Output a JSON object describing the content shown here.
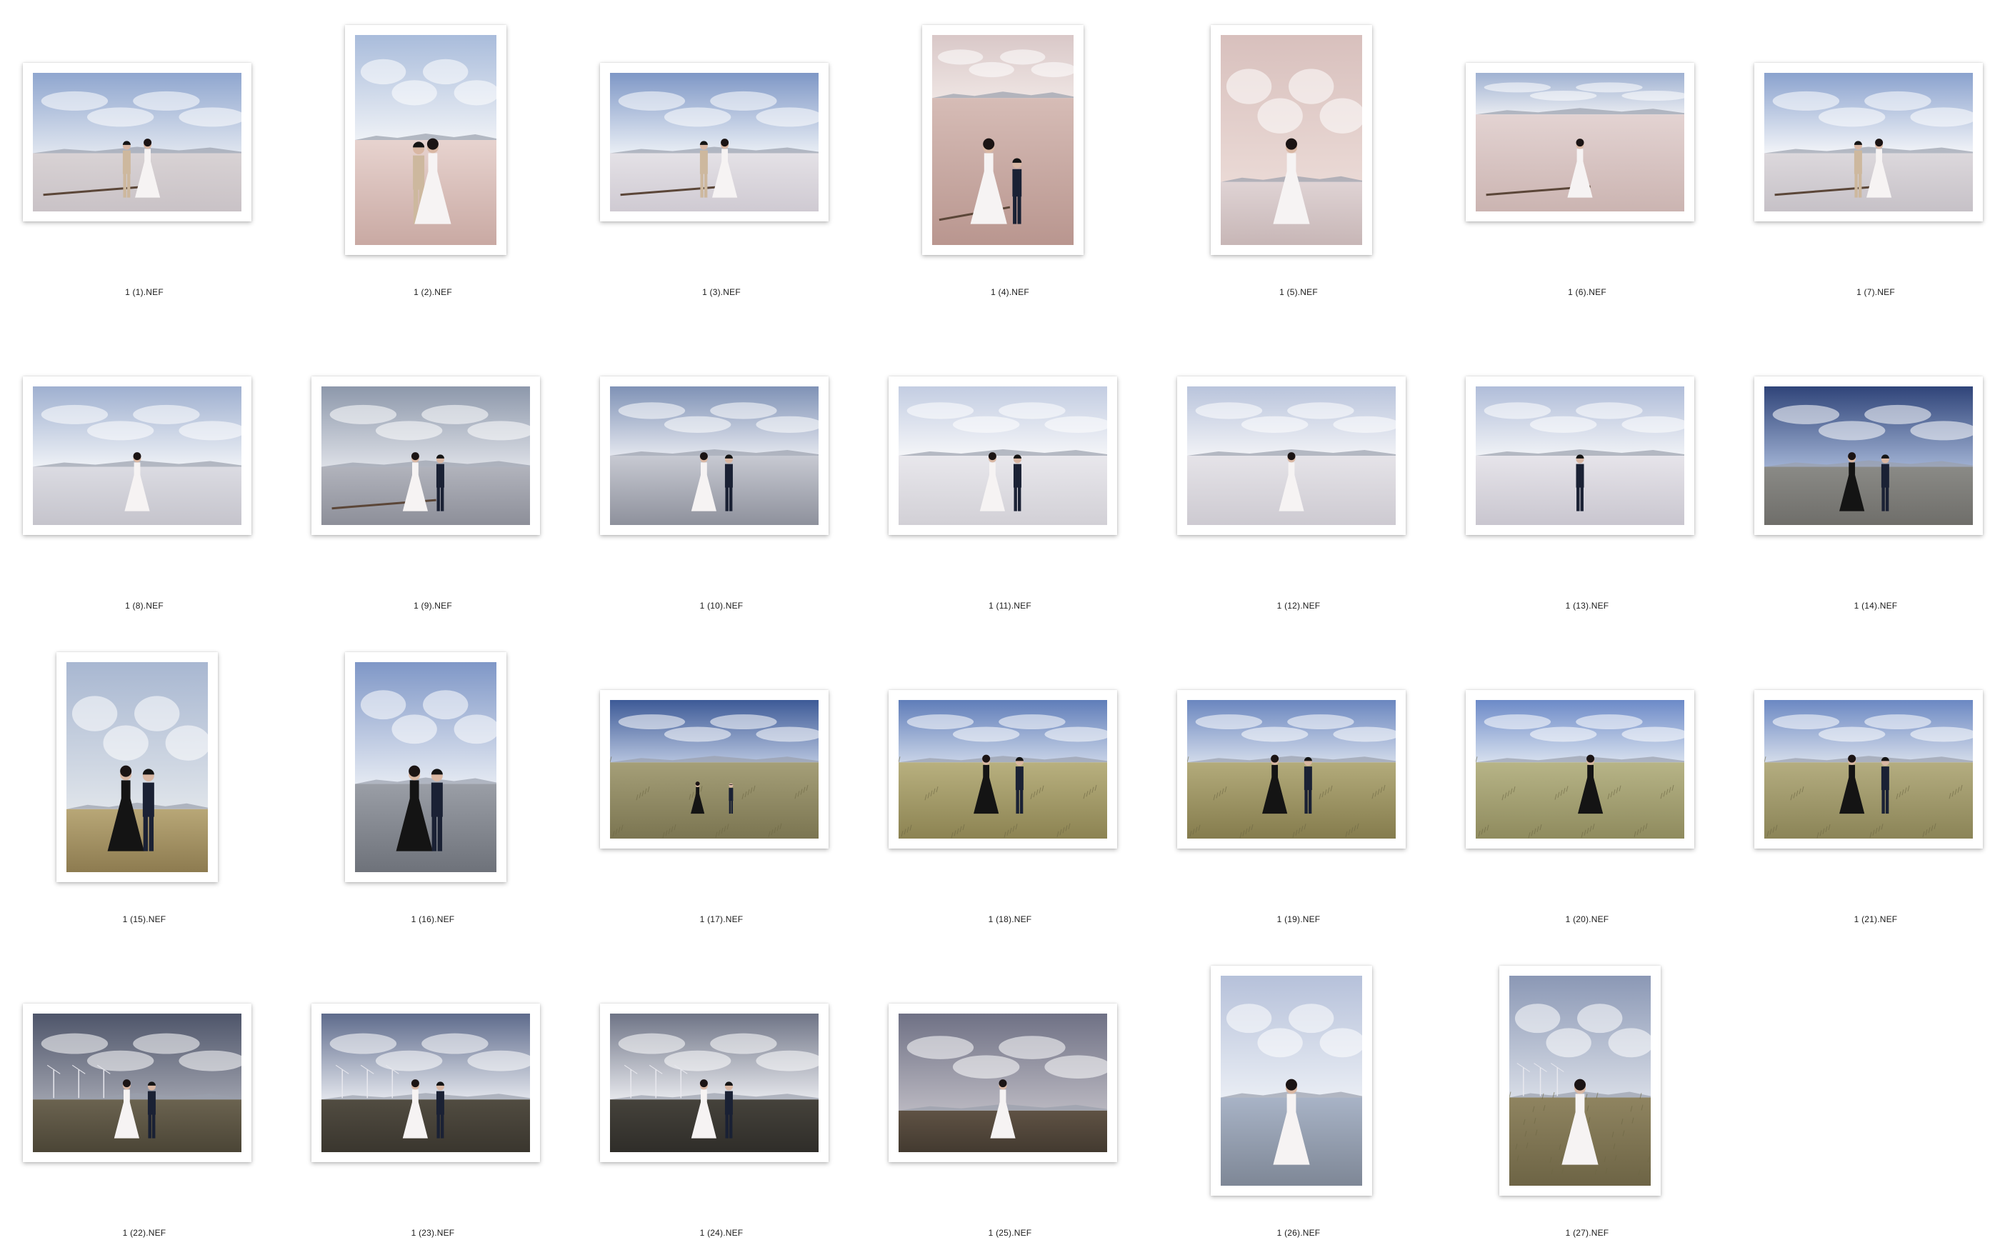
{
  "photos": [
    {
      "filename": "1 (1).NEF",
      "orientation": "landscape",
      "scene": "salt-lake",
      "sky": [
        "#8fa6cf",
        "#dfe5ef"
      ],
      "ground": [
        "#d8d2d4",
        "#c9c2c6"
      ],
      "subject": "couple-light"
    },
    {
      "filename": "1 (2).NEF",
      "orientation": "portrait",
      "scene": "reflection",
      "sky": [
        "#a9bcdb",
        "#eef1f6"
      ],
      "ground": [
        "#e7d3cf",
        "#c9a9a3"
      ],
      "subject": "couple-light"
    },
    {
      "filename": "1 (3).NEF",
      "orientation": "landscape",
      "scene": "salt-lake",
      "sky": [
        "#7e97c6",
        "#e9eef5"
      ],
      "ground": [
        "#e4e1e6",
        "#cfcad2"
      ],
      "subject": "couple-light"
    },
    {
      "filename": "1 (4).NEF",
      "orientation": "portrait",
      "scene": "salt-rails",
      "sky": [
        "#d9c8c8",
        "#eee4e2"
      ],
      "ground": [
        "#d6bcb6",
        "#b9968f"
      ],
      "subject": "couple-sitting"
    },
    {
      "filename": "1 (5).NEF",
      "orientation": "portrait",
      "scene": "bride-close",
      "sky": [
        "#d8c0bd",
        "#ead9d5"
      ],
      "ground": [
        "#dfd3d4",
        "#c7b6b6"
      ],
      "subject": "bride-white"
    },
    {
      "filename": "1 (6).NEF",
      "orientation": "landscape",
      "scene": "salt-rails",
      "sky": [
        "#9fb1d2",
        "#e8ebf1"
      ],
      "ground": [
        "#e3d3d2",
        "#cbb4b1"
      ],
      "subject": "bride-white"
    },
    {
      "filename": "1 (7).NEF",
      "orientation": "landscape",
      "scene": "salt-lake",
      "sky": [
        "#8aa2ce",
        "#f2f4f8"
      ],
      "ground": [
        "#dcd8dc",
        "#c6c1c7"
      ],
      "subject": "couple-light"
    },
    {
      "filename": "1 (8).NEF",
      "orientation": "landscape",
      "scene": "bride-veil",
      "sky": [
        "#9fb0d0",
        "#eef1f6"
      ],
      "ground": [
        "#dbdbe2",
        "#c5c4cc"
      ],
      "subject": "bride-white"
    },
    {
      "filename": "1 (9).NEF",
      "orientation": "landscape",
      "scene": "salt-lake",
      "sky": [
        "#8d98ab",
        "#dcdfe6"
      ],
      "ground": [
        "#b1b3bc",
        "#8d8f99"
      ],
      "subject": "couple-dark"
    },
    {
      "filename": "1 (10).NEF",
      "orientation": "landscape",
      "scene": "reflection",
      "sky": [
        "#7f92b6",
        "#e3e6ee"
      ],
      "ground": [
        "#c7c9d2",
        "#8e919c"
      ],
      "subject": "couple-dark"
    },
    {
      "filename": "1 (11).NEF",
      "orientation": "landscape",
      "scene": "reflection",
      "sky": [
        "#c3cde2",
        "#f4f5f8"
      ],
      "ground": [
        "#e8e7ec",
        "#d2d0d6"
      ],
      "subject": "couple-dark"
    },
    {
      "filename": "1 (12).NEF",
      "orientation": "landscape",
      "scene": "reflection",
      "sky": [
        "#b9c4dc",
        "#f1f2f6"
      ],
      "ground": [
        "#e5e3e8",
        "#cdcad1"
      ],
      "subject": "bride-white"
    },
    {
      "filename": "1 (13).NEF",
      "orientation": "landscape",
      "scene": "reflection",
      "sky": [
        "#b0bdd9",
        "#f0f2f6"
      ],
      "ground": [
        "#e6e4ea",
        "#c9c6cf"
      ],
      "subject": "groom-dark"
    },
    {
      "filename": "1 (14).NEF",
      "orientation": "landscape",
      "scene": "blue-sky",
      "sky": [
        "#2f4479",
        "#9fb0d2"
      ],
      "ground": [
        "#8a8a86",
        "#6f6e6a"
      ],
      "subject": "couple-black"
    },
    {
      "filename": "1 (15).NEF",
      "orientation": "portrait",
      "scene": "embrace",
      "sky": [
        "#a8b7d1",
        "#dfe4ea"
      ],
      "ground": [
        "#b8a777",
        "#8d7b50"
      ],
      "subject": "couple-embrace"
    },
    {
      "filename": "1 (16).NEF",
      "orientation": "portrait",
      "scene": "road-sit",
      "sky": [
        "#7f97c7",
        "#e4e9f2"
      ],
      "ground": [
        "#9a9ea6",
        "#6e727a"
      ],
      "subject": "couple-black"
    },
    {
      "filename": "1 (17).NEF",
      "orientation": "landscape",
      "scene": "grassland",
      "sky": [
        "#3d5a97",
        "#b5c3de"
      ],
      "ground": [
        "#a59f78",
        "#7b7551"
      ],
      "subject": "couple-small"
    },
    {
      "filename": "1 (18).NEF",
      "orientation": "landscape",
      "scene": "grassland",
      "sky": [
        "#5f7db9",
        "#c8d3e7"
      ],
      "ground": [
        "#b8b07f",
        "#8c8352"
      ],
      "subject": "couple-black"
    },
    {
      "filename": "1 (19).NEF",
      "orientation": "landscape",
      "scene": "grassland",
      "sky": [
        "#6a86bf",
        "#d1daea"
      ],
      "ground": [
        "#b3ab7b",
        "#857c4d"
      ],
      "subject": "couple-black"
    },
    {
      "filename": "1 (20).NEF",
      "orientation": "landscape",
      "scene": "grassland",
      "sky": [
        "#6c8ac8",
        "#d7e0ee"
      ],
      "ground": [
        "#b7b487",
        "#8f8b5e"
      ],
      "subject": "bride-black"
    },
    {
      "filename": "1 (21).NEF",
      "orientation": "landscape",
      "scene": "grassland",
      "sky": [
        "#6b88c3",
        "#d4dcea"
      ],
      "ground": [
        "#b4ad80",
        "#8b8457"
      ],
      "subject": "couple-black"
    },
    {
      "filename": "1 (22).NEF",
      "orientation": "landscape",
      "scene": "dusk",
      "sky": [
        "#4e556a",
        "#9c9fab"
      ],
      "ground": [
        "#6b6350",
        "#4b4536"
      ],
      "subject": "couple-gown"
    },
    {
      "filename": "1 (23).NEF",
      "orientation": "landscape",
      "scene": "dusk",
      "sky": [
        "#5e6b8c",
        "#e2e5ec"
      ],
      "ground": [
        "#514c41",
        "#3a362e"
      ],
      "subject": "couple-gown"
    },
    {
      "filename": "1 (24).NEF",
      "orientation": "landscape",
      "scene": "dusk",
      "sky": [
        "#6e7486",
        "#e6e7ec"
      ],
      "ground": [
        "#45423b",
        "#2f2d29"
      ],
      "subject": "couple-kiss"
    },
    {
      "filename": "1 (25).NEF",
      "orientation": "landscape",
      "scene": "bride-close",
      "sky": [
        "#6f7185",
        "#b9b7c0"
      ],
      "ground": [
        "#5f5244",
        "#433a30"
      ],
      "subject": "bride-bouquet"
    },
    {
      "filename": "1 (26).NEF",
      "orientation": "portrait",
      "scene": "railing",
      "sky": [
        "#b6c1da",
        "#e9edf4"
      ],
      "ground": [
        "#a8b3c6",
        "#7e8796"
      ],
      "subject": "bride-white"
    },
    {
      "filename": "1 (27).NEF",
      "orientation": "portrait",
      "scene": "wind-farm",
      "sky": [
        "#8b98b5",
        "#d7dce6"
      ],
      "ground": [
        "#8f8460",
        "#6d6445"
      ],
      "subject": "bride-gown"
    }
  ]
}
